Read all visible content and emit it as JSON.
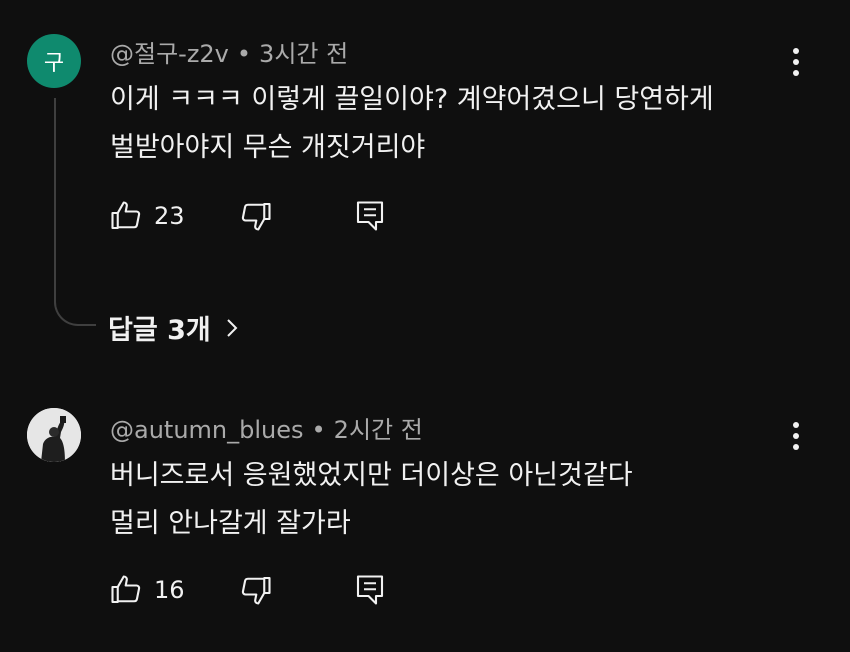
{
  "comments": [
    {
      "avatar_letter": "구",
      "avatar_color": "#0f8a6e",
      "author": "@절구-z2v",
      "separator": "•",
      "time": "3시간 전",
      "lines": [
        "이게 ㅋㅋㅋ 이렇게 끌일이야? 계약어겼으니 당연하게",
        "벌받아야지 무슨 개짓거리야"
      ],
      "likes": "23",
      "replies_label": "답글 3개"
    },
    {
      "avatar_icon": "user-photo",
      "author": "@autumn_blues",
      "separator": "•",
      "time": "2시간 전",
      "lines": [
        "버니즈로서 응원했었지만 더이상은 아닌것같다",
        "멀리 안나갈게 잘가라"
      ],
      "likes": "16"
    }
  ],
  "icons": {
    "like": "thumbs-up-icon",
    "dislike": "thumbs-down-icon",
    "reply": "reply-comment-icon",
    "more": "more-vertical-icon",
    "chevron": "chevron-right-icon"
  }
}
